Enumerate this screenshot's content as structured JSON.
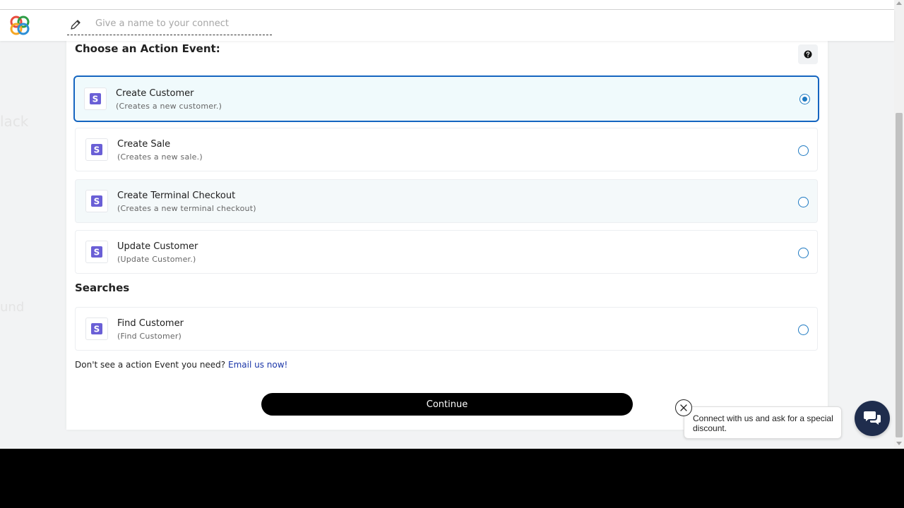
{
  "header": {
    "name_placeholder": "Give a name to your connect"
  },
  "background": {
    "partial_labels": [
      "lack",
      "und"
    ]
  },
  "action_section": {
    "title": "Choose an Action Event:",
    "options": [
      {
        "title": "Create Customer",
        "desc": "(Creates a new customer.)",
        "selected": true
      },
      {
        "title": "Create Sale",
        "desc": "(Creates a new sale.)",
        "selected": false
      },
      {
        "title": "Create Terminal Checkout",
        "desc": "(Creates a new terminal checkout)",
        "selected": false
      },
      {
        "title": "Update Customer",
        "desc": "(Update Customer.)",
        "selected": false
      }
    ]
  },
  "search_section": {
    "title": "Searches",
    "options": [
      {
        "title": "Find Customer",
        "desc": "(Find Customer)",
        "selected": false
      }
    ]
  },
  "footer_hint": {
    "text": "Don't see a action Event you need?",
    "link": "Email us now!"
  },
  "continue_label": "Continue",
  "promo": {
    "text": "Connect with us and ask for a special discount."
  },
  "app_icon_letter": "S",
  "colors": {
    "accent": "#1565c0",
    "radio": "#1f7ac2",
    "link": "#1a35a8",
    "app_icon": "#6a5fd6",
    "chat_button": "#1f2d4d",
    "continue_button": "#000000"
  },
  "icons": [
    "logo-icon",
    "pencil-icon",
    "help-icon",
    "app-s-icon",
    "close-icon",
    "chat-icon"
  ]
}
